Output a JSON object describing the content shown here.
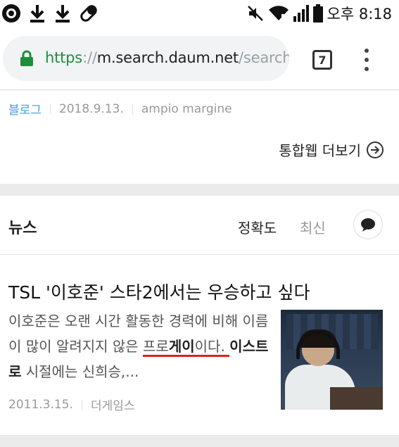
{
  "status_bar": {
    "time": "오후 8:18",
    "left_icons": [
      "record-icon",
      "download-icon",
      "download-icon",
      "pill-icon"
    ],
    "right_icons": [
      "mute-icon",
      "wifi-icon",
      "signal-icon",
      "battery-icon"
    ]
  },
  "browser": {
    "url_scheme": "https",
    "url_sep": "://",
    "url_host": "m.search.daum.net",
    "url_path": "/search?",
    "tab_count": "7"
  },
  "blog_result": {
    "source": "블로그",
    "date": "2018.9.13.",
    "author": "ampio margine",
    "more_link": "통합웹 더보기"
  },
  "news": {
    "section_title": "뉴스",
    "sort_accuracy": "정확도",
    "sort_latest": "최신",
    "article": {
      "title": "TSL '이호준' 스타2에서는 우승하고 싶다",
      "body_part1": "이호준은 오랜 시간 활동한 경력에 비해 이름이 많이 알려지지 않은 ",
      "body_hl1": "프로",
      "body_hl2": "게",
      "body_hl3": "이",
      "body_part2": "이다. ",
      "body_bold2": "이스트로",
      "body_part3": " 시절에는 신희승,...",
      "date": "2011.3.15.",
      "publisher": "더게임스"
    }
  },
  "colors": {
    "accent_green": "#1e8e3e",
    "source_blue": "#3e9fd6",
    "underline_red": "#e02020"
  }
}
